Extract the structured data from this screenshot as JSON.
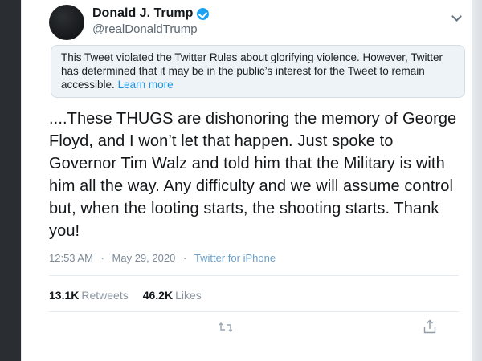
{
  "user": {
    "display_name": "Donald J. Trump",
    "handle": "@realDonaldTrump",
    "avatar_icon": "profile-avatar",
    "verified_icon": "verified-badge-icon",
    "verified_color": "#1da1f2"
  },
  "notice": {
    "text": "This Tweet violated the Twitter Rules about glorifying violence. However, Twitter has determined that it may be in the public’s interest for the Tweet to remain accessible.",
    "link_label": "Learn more"
  },
  "tweet": {
    "text": "....These THUGS are dishonoring the memory of George Floyd, and I won’t let that happen. Just spoke to Governor Tim Walz and told him that the Military is with him all the way. Any difficulty and we will assume control but, when the looting starts, the shooting starts. Thank you!"
  },
  "meta": {
    "time": "12:53 AM",
    "separator": "·",
    "date": "May 29, 2020",
    "source": "Twitter for iPhone"
  },
  "stats": {
    "retweets_count": "13.1K",
    "retweets_label": "Retweets",
    "likes_count": "46.2K",
    "likes_label": "Likes"
  },
  "actions": {
    "retweet_icon": "retweet-icon",
    "share_icon": "share-icon",
    "menu_icon": "chevron-down-icon"
  }
}
